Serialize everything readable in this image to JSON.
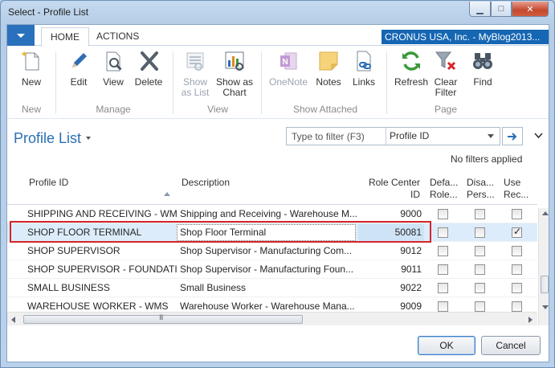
{
  "window": {
    "title": "Select - Profile List"
  },
  "ribbon": {
    "tabs": [
      {
        "label": "HOME",
        "active": true
      },
      {
        "label": "ACTIONS",
        "active": false
      }
    ],
    "company": "CRONUS USA, Inc. - MyBlog2013...",
    "buttons": {
      "new": "New",
      "edit": "Edit",
      "view": "View",
      "delete": "Delete",
      "show_as_list_1": "Show",
      "show_as_list_2": "as List",
      "show_as_chart_1": "Show as",
      "show_as_chart_2": "Chart",
      "onenote": "OneNote",
      "notes": "Notes",
      "links": "Links",
      "refresh": "Refresh",
      "clear_filter_1": "Clear",
      "clear_filter_2": "Filter",
      "find": "Find"
    },
    "groups": {
      "new": "New",
      "manage": "Manage",
      "view": "View",
      "show_attached": "Show Attached",
      "page": "Page"
    }
  },
  "page": {
    "title": "Profile List",
    "filter_placeholder": "Type to filter (F3)",
    "filter_field": "Profile ID",
    "filter_status": "No filters applied"
  },
  "grid": {
    "headers": {
      "profile_id": "Profile ID",
      "description": "Description",
      "role_center_1": "Role Center",
      "role_center_2": "ID",
      "default_1": "Defa...",
      "default_2": "Role...",
      "disable_1": "Disa...",
      "disable_2": "Pers...",
      "use_1": "Use",
      "use_2": "Rec..."
    },
    "rows": [
      {
        "profile_id": "SHIPPING AND RECEIVING - WMS",
        "description": "Shipping and Receiving - Warehouse M...",
        "role_center_id": "9000",
        "default": false,
        "disable": false,
        "use": false,
        "selected": false
      },
      {
        "profile_id": "SHOP FLOOR TERMINAL",
        "description": "Shop Floor Terminal",
        "role_center_id": "50081",
        "default": false,
        "disable": false,
        "use": true,
        "selected": true
      },
      {
        "profile_id": "SHOP SUPERVISOR",
        "description": "Shop Supervisor - Manufacturing Com...",
        "role_center_id": "9012",
        "default": false,
        "disable": false,
        "use": false,
        "selected": false
      },
      {
        "profile_id": "SHOP SUPERVISOR - FOUNDATI...",
        "description": "Shop Supervisor - Manufacturing Foun...",
        "role_center_id": "9011",
        "default": false,
        "disable": false,
        "use": false,
        "selected": false
      },
      {
        "profile_id": "SMALL BUSINESS",
        "description": "Small Business",
        "role_center_id": "9022",
        "default": false,
        "disable": false,
        "use": false,
        "selected": false
      },
      {
        "profile_id": "WAREHOUSE WORKER - WMS",
        "description": "Warehouse Worker - Warehouse Mana...",
        "role_center_id": "9009",
        "default": false,
        "disable": false,
        "use": false,
        "selected": false
      }
    ]
  },
  "scroll": {
    "grip": "III"
  },
  "footer": {
    "ok": "OK",
    "cancel": "Cancel"
  },
  "colors": {
    "accent": "#2a71bd",
    "title_blue": "#2a6fb3",
    "highlight_border": "#d4252b",
    "selected_row": "#ddecfa"
  }
}
